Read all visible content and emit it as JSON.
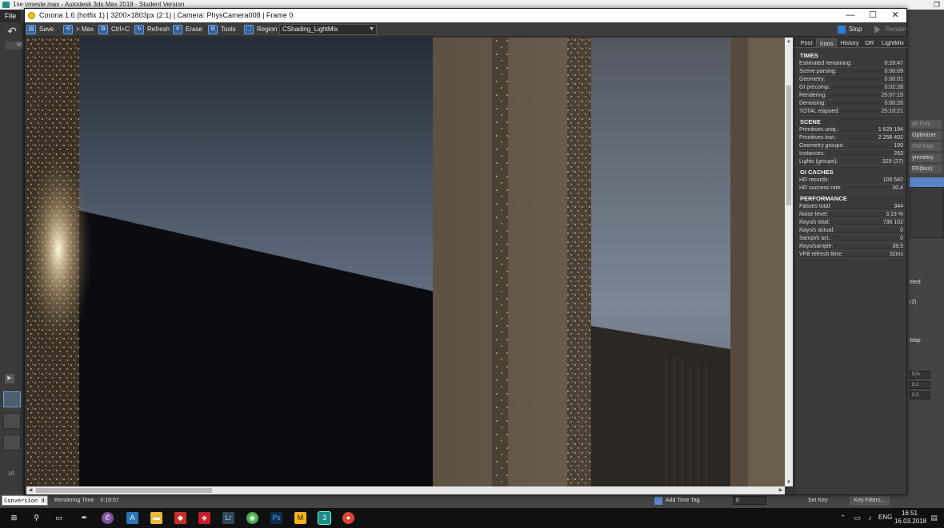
{
  "max": {
    "title": "1se vmeste.max - Autodesk 3ds Max 2018 - Student Version",
    "menu_file": "File",
    "left_panel": {
      "m_label": "M",
      "frame_label": "1/\\"
    },
    "right_panel": {
      "buttons": [
        "dit Poly",
        "Optimizer",
        "VW Map",
        "ymmetry",
        "FD(box)"
      ],
      "labels": [
        "eted",
        "r2)",
        "Map"
      ],
      "fields": [
        "57e",
        "8.2",
        "0.2"
      ]
    },
    "status": {
      "conversion": "Conversion d:",
      "rendering_time_label": "Rendering Time",
      "rendering_time_value": "0:19:57",
      "add_time_tag": "Add Time Tag",
      "frame_value": "0",
      "set_key": "Set Key",
      "key_filters": "Key Filters..."
    }
  },
  "vfb": {
    "title": "Corona 1.6 (hotfix 1) | 3200×1803px (2:1) | Camera: PhysCamera008 | Frame 0",
    "toolbar": {
      "save": "Save",
      "to_max": "> Max",
      "ctrl_c": "Ctrl+C",
      "refresh": "Refresh",
      "erase": "Erase",
      "tools": "Tools",
      "region": "Region",
      "render_element": "CShading_LightMix",
      "stop": "Stop",
      "render": "Render"
    },
    "tabs": [
      "Post",
      "Stats",
      "History",
      "DR",
      "LightMix"
    ],
    "active_tab": "Stats",
    "stats": {
      "times": {
        "title": "TIMES",
        "rows": [
          {
            "k": "Estimated remaining:",
            "v": "0:28:47"
          },
          {
            "k": "Scene parsing:",
            "v": "0:00:09"
          },
          {
            "k": "Geometry:",
            "v": "0:00:01"
          },
          {
            "k": "GI precomp:",
            "v": "0:02:28"
          },
          {
            "k": "Rendering:",
            "v": "25:07:15"
          },
          {
            "k": "Denoising:",
            "v": "0:00:26"
          },
          {
            "k": "TOTAL elapsed:",
            "v": "25:10:21"
          }
        ]
      },
      "scene": {
        "title": "SCENE",
        "rows": [
          {
            "k": "Primitives uniq.:",
            "v": "1 629 194"
          },
          {
            "k": "Primitives inst.:",
            "v": "2 256 402"
          },
          {
            "k": "Geometry groups:",
            "v": "199"
          },
          {
            "k": "Instances:",
            "v": "263"
          },
          {
            "k": "Lights (groups):",
            "v": "329 (27)"
          }
        ]
      },
      "gi_caches": {
        "title": "GI CACHES",
        "rows": [
          {
            "k": "HD records:",
            "v": "100 542"
          },
          {
            "k": "HD success rate:",
            "v": "30,4"
          }
        ]
      },
      "performance": {
        "title": "PERFORMANCE",
        "rows": [
          {
            "k": "Passes total:",
            "v": "344"
          },
          {
            "k": "Noise level:",
            "v": "3,19 %"
          },
          {
            "k": "Rays/s total:",
            "v": "736 102"
          },
          {
            "k": "Rays/s actual:",
            "v": "0"
          },
          {
            "k": "Sampl/s act.:",
            "v": "0"
          },
          {
            "k": "Rays/sample:",
            "v": "39,5"
          },
          {
            "k": "VFB refresh time:",
            "v": "32ms"
          }
        ]
      }
    }
  },
  "taskbar": {
    "time": "16:51",
    "date": "16.03.2018",
    "lang": "ENG",
    "app_icons": [
      "start-icon",
      "search-icon",
      "task-view-icon",
      "inkscape-icon",
      "viber-icon",
      "autodesk-icon",
      "explorer-icon",
      "sketchup-icon",
      "autocad-icon",
      "lightroom-icon",
      "globe-icon",
      "photoshop-icon",
      "mailbird-icon",
      "3dsmax-icon",
      "chrome-icon"
    ]
  },
  "colors": {
    "vfb_bg": "#333333",
    "accent_blue": "#2e5f9a",
    "stop_blue": "#2f7fd6"
  }
}
